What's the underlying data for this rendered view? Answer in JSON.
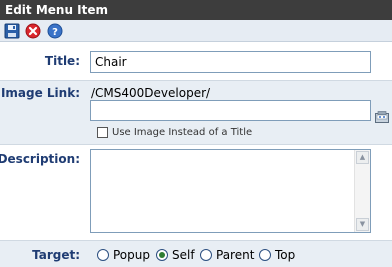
{
  "window": {
    "title": "Edit Menu Item"
  },
  "toolbar": {
    "buttons": [
      {
        "name": "save",
        "icon": "save-icon"
      },
      {
        "name": "cancel",
        "icon": "cancel-icon"
      },
      {
        "name": "help",
        "icon": "help-icon"
      }
    ]
  },
  "form": {
    "title": {
      "label": "Title:",
      "value": "Chair"
    },
    "image_link": {
      "label": "Image Link:",
      "path": "/CMS400Developer/",
      "value": "",
      "browse_icon": "browse-image-icon",
      "checkbox_label": "Use Image Instead of a Title",
      "checkbox_checked": false
    },
    "description": {
      "label": "Description:",
      "value": ""
    },
    "target": {
      "label": "Target:",
      "options": [
        "Popup",
        "Self",
        "Parent",
        "Top"
      ],
      "selected": "Self"
    }
  },
  "colors": {
    "titlebar": "#3d3d3d",
    "label": "#1f3c73",
    "row_alt": "#e8eef4",
    "radio_selected": "#2e7d32"
  }
}
